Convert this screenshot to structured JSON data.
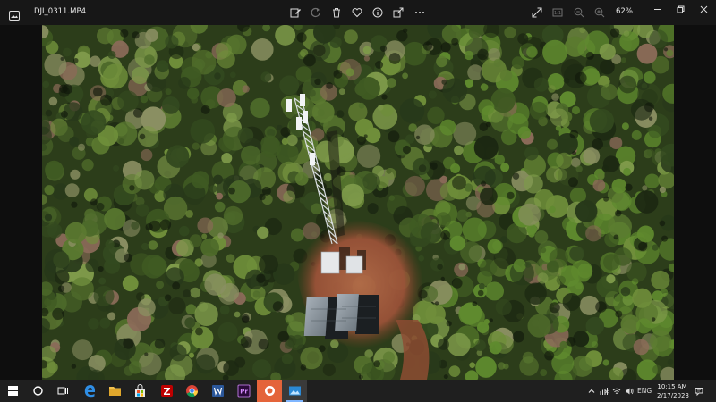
{
  "titlebar": {
    "filename": "DJI_0311.MP4",
    "zoom": "62%",
    "toolbar_icons": [
      "edit-create-icon",
      "rotate-icon",
      "delete-icon",
      "favorite-icon",
      "info-icon",
      "share-icon",
      "more-icon"
    ],
    "right_icons": [
      "expand-icon",
      "fit-icon",
      "zoom-out-icon",
      "zoom-in-icon"
    ]
  },
  "image": {
    "description_icon": "aerial-drone-photo",
    "colors": {
      "forest_dark": "#1f2a14",
      "forest_mid": "#3f5a22",
      "forest_light": "#6f8e3a",
      "dirt": "#a0553a"
    }
  },
  "taskbar": {
    "apps": [
      "start-icon",
      "search-icon",
      "task-view-icon",
      "edge-icon",
      "file-explorer-icon",
      "store-icon",
      "filezilla-icon",
      "chrome-icon",
      "word-icon",
      "premiere-icon",
      "photos-app-icon",
      "photos-icon"
    ],
    "lang": "ENG",
    "time": "10:15 AM",
    "date": "2/17/2023"
  }
}
